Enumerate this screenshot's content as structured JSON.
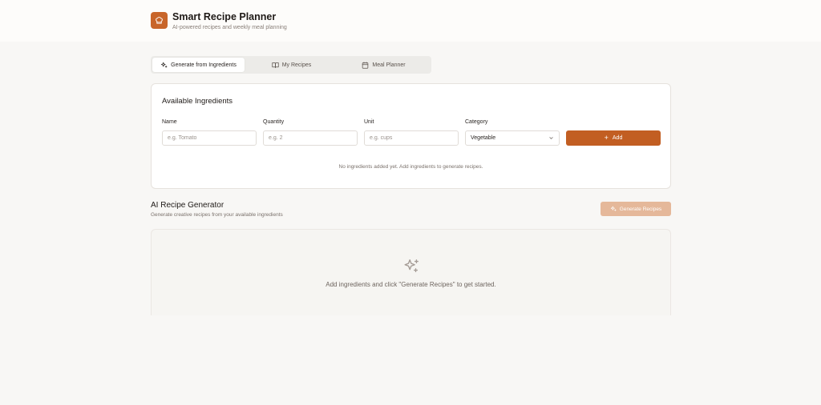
{
  "header": {
    "title": "Smart Recipe Planner",
    "subtitle": "AI-powered recipes and weekly meal planning",
    "logo_icon": "chef-hat-icon"
  },
  "tabs": [
    {
      "label": "Generate from Ingredients",
      "icon": "sparkles-icon",
      "active": true
    },
    {
      "label": "My Recipes",
      "icon": "book-icon",
      "active": false
    },
    {
      "label": "Meal Planner",
      "icon": "calendar-icon",
      "active": false
    }
  ],
  "ingredients": {
    "title": "Available Ingredients",
    "fields": {
      "name": {
        "label": "Name",
        "placeholder": "e.g. Tomato",
        "value": ""
      },
      "quantity": {
        "label": "Quantity",
        "placeholder": "e.g. 2",
        "value": ""
      },
      "unit": {
        "label": "Unit",
        "placeholder": "e.g. cups",
        "value": ""
      },
      "category": {
        "label": "Category",
        "value": "Vegetable"
      }
    },
    "add_label": "Add",
    "empty_text": "No ingredients added yet. Add ingredients to generate recipes."
  },
  "generator": {
    "title": "AI Recipe Generator",
    "subtitle": "Generate creative recipes from your available ingredients",
    "button_label": "Generate Recipes",
    "empty_text": "Add ingredients and click \"Generate Recipes\" to get started."
  },
  "colors": {
    "accent": "#c25e22",
    "accent_disabled": "#e5b89a",
    "background": "#f8f7f5"
  }
}
